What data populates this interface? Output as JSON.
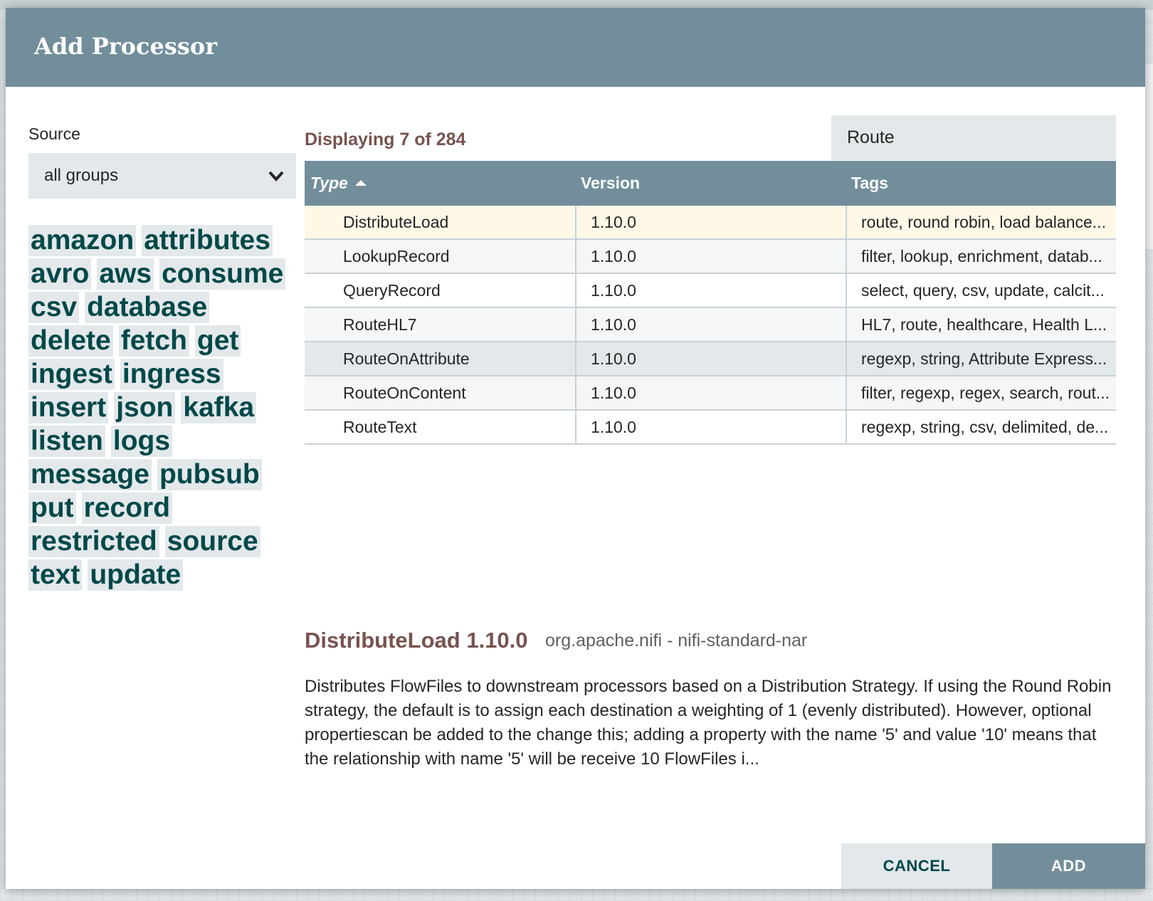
{
  "dialog": {
    "title": "Add Processor"
  },
  "source": {
    "label": "Source",
    "selected": "all groups"
  },
  "tags": [
    [
      "amazon",
      "attributes"
    ],
    [
      "avro",
      "aws",
      "consume"
    ],
    [
      "csv",
      "database"
    ],
    [
      "delete",
      "fetch",
      "get"
    ],
    [
      "ingest",
      "ingress"
    ],
    [
      "insert",
      "json",
      "kafka"
    ],
    [
      "listen",
      "logs"
    ],
    [
      "message",
      "pubsub"
    ],
    [
      "put",
      "record"
    ],
    [
      "restricted",
      "source"
    ],
    [
      "text",
      "update"
    ]
  ],
  "results": {
    "count_text": "Displaying 7 of 284"
  },
  "filter": {
    "value": "Route"
  },
  "grid": {
    "headers": {
      "type": "Type",
      "version": "Version",
      "tags": "Tags"
    },
    "rows": [
      {
        "type": "DistributeLoad",
        "version": "1.10.0",
        "tags": "route, round robin, load balance..."
      },
      {
        "type": "LookupRecord",
        "version": "1.10.0",
        "tags": "filter, lookup, enrichment, datab..."
      },
      {
        "type": "QueryRecord",
        "version": "1.10.0",
        "tags": "select, query, csv, update, calcit..."
      },
      {
        "type": "RouteHL7",
        "version": "1.10.0",
        "tags": "HL7, route, healthcare, Health L..."
      },
      {
        "type": "RouteOnAttribute",
        "version": "1.10.0",
        "tags": "regexp, string, Attribute Express..."
      },
      {
        "type": "RouteOnContent",
        "version": "1.10.0",
        "tags": "filter, regexp, regex, search, rout..."
      },
      {
        "type": "RouteText",
        "version": "1.10.0",
        "tags": "regexp, string, csv, delimited, de..."
      }
    ]
  },
  "detail": {
    "title": "DistributeLoad 1.10.0",
    "bundle": "org.apache.nifi - nifi-standard-nar",
    "description": "Distributes FlowFiles to downstream processors based on a Distribution Strategy. If using the Round Robin strategy, the default is to assign each destination a weighting of 1 (evenly distributed). However, optional propertiescan be added to the change this; adding a property with the name '5' and value '10' means that the relationship with name '5' will be receive 10 FlowFiles i..."
  },
  "buttons": {
    "cancel": "CANCEL",
    "add": "ADD"
  },
  "colors": {
    "header": "#728e9b",
    "accent_text": "#775351",
    "tag_text": "#004849",
    "tag_bg": "#e3e8eb",
    "selected_row": "#fff8e7"
  }
}
